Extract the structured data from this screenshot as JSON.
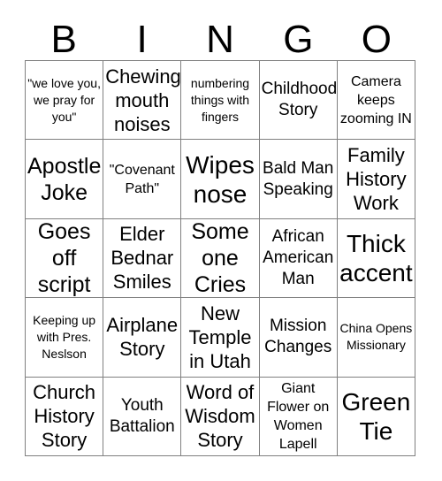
{
  "card": {
    "header_letters": [
      "B",
      "I",
      "N",
      "G",
      "O"
    ],
    "colors": {
      "text": "#000000",
      "border": "#808080",
      "background": "#ffffff"
    },
    "grid": {
      "rows": 5,
      "columns": 5
    },
    "cells": [
      [
        {
          "text": "\"we love you, we pray for you\"",
          "size": "xs"
        },
        {
          "text": "Chewing mouth noises",
          "size": "lg"
        },
        {
          "text": "numbering things with fingers",
          "size": "xs"
        },
        {
          "text": "Childhood Story",
          "size": "md"
        },
        {
          "text": "Camera keeps zooming IN",
          "size": "sm"
        }
      ],
      [
        {
          "text": "Apostle Joke",
          "size": "xl"
        },
        {
          "text": "\"Covenant Path\"",
          "size": "sm"
        },
        {
          "text": "Wipes nose",
          "size": "xxl"
        },
        {
          "text": "Bald Man Speaking",
          "size": "md"
        },
        {
          "text": "Family History Work",
          "size": "lg"
        }
      ],
      [
        {
          "text": "Goes off script",
          "size": "xl"
        },
        {
          "text": "Elder Bednar Smiles",
          "size": "lg"
        },
        {
          "text": "Some one Cries",
          "size": "xl"
        },
        {
          "text": "African American Man",
          "size": "md"
        },
        {
          "text": "Thick accent",
          "size": "xxl"
        }
      ],
      [
        {
          "text": "Keeping up with Pres. Neslson",
          "size": "xs"
        },
        {
          "text": "Airplane Story",
          "size": "lg"
        },
        {
          "text": "New Temple in Utah",
          "size": "lg"
        },
        {
          "text": "Mission Changes",
          "size": "md"
        },
        {
          "text": "China Opens Missionary",
          "size": "xs"
        }
      ],
      [
        {
          "text": "Church History Story",
          "size": "lg"
        },
        {
          "text": "Youth Battalion",
          "size": "md"
        },
        {
          "text": "Word of Wisdom Story",
          "size": "lg"
        },
        {
          "text": "Giant Flower on Women Lapell",
          "size": "sm"
        },
        {
          "text": "Green Tie",
          "size": "xxl"
        }
      ]
    ]
  }
}
